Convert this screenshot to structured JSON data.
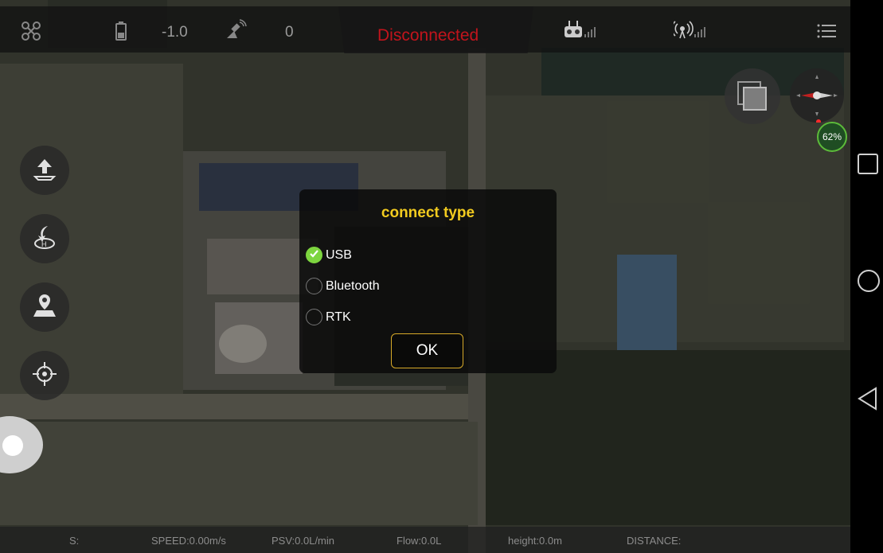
{
  "topbar": {
    "altitude": "-1.0",
    "satellites": "0",
    "connection_status": "Disconnected"
  },
  "dialog": {
    "title": "connect type",
    "options": [
      {
        "label": "USB",
        "checked": true
      },
      {
        "label": "Bluetooth",
        "checked": false
      },
      {
        "label": "RTK",
        "checked": false
      }
    ],
    "ok_label": "OK"
  },
  "bottom": {
    "s": "S:",
    "speed": "SPEED:0.00m/s",
    "psv": "PSV:0.0L/min",
    "flow": "Flow:0.0L",
    "height": "height:0.0m",
    "distance": "DISTANCE:"
  },
  "battery_percent": "62%",
  "icons": [
    "drone-icon",
    "battery-icon",
    "satellite-icon",
    "remote-controller-icon",
    "signal-icon",
    "menu-icon",
    "takeoff-icon",
    "return-home-icon",
    "map-location-icon",
    "locate-icon",
    "layers-icon",
    "compass-icon"
  ],
  "colors": {
    "accent": "#f2cb1f",
    "status_red": "#c2141c",
    "check_green": "#7dd53f",
    "ok_border": "#d7a928"
  }
}
